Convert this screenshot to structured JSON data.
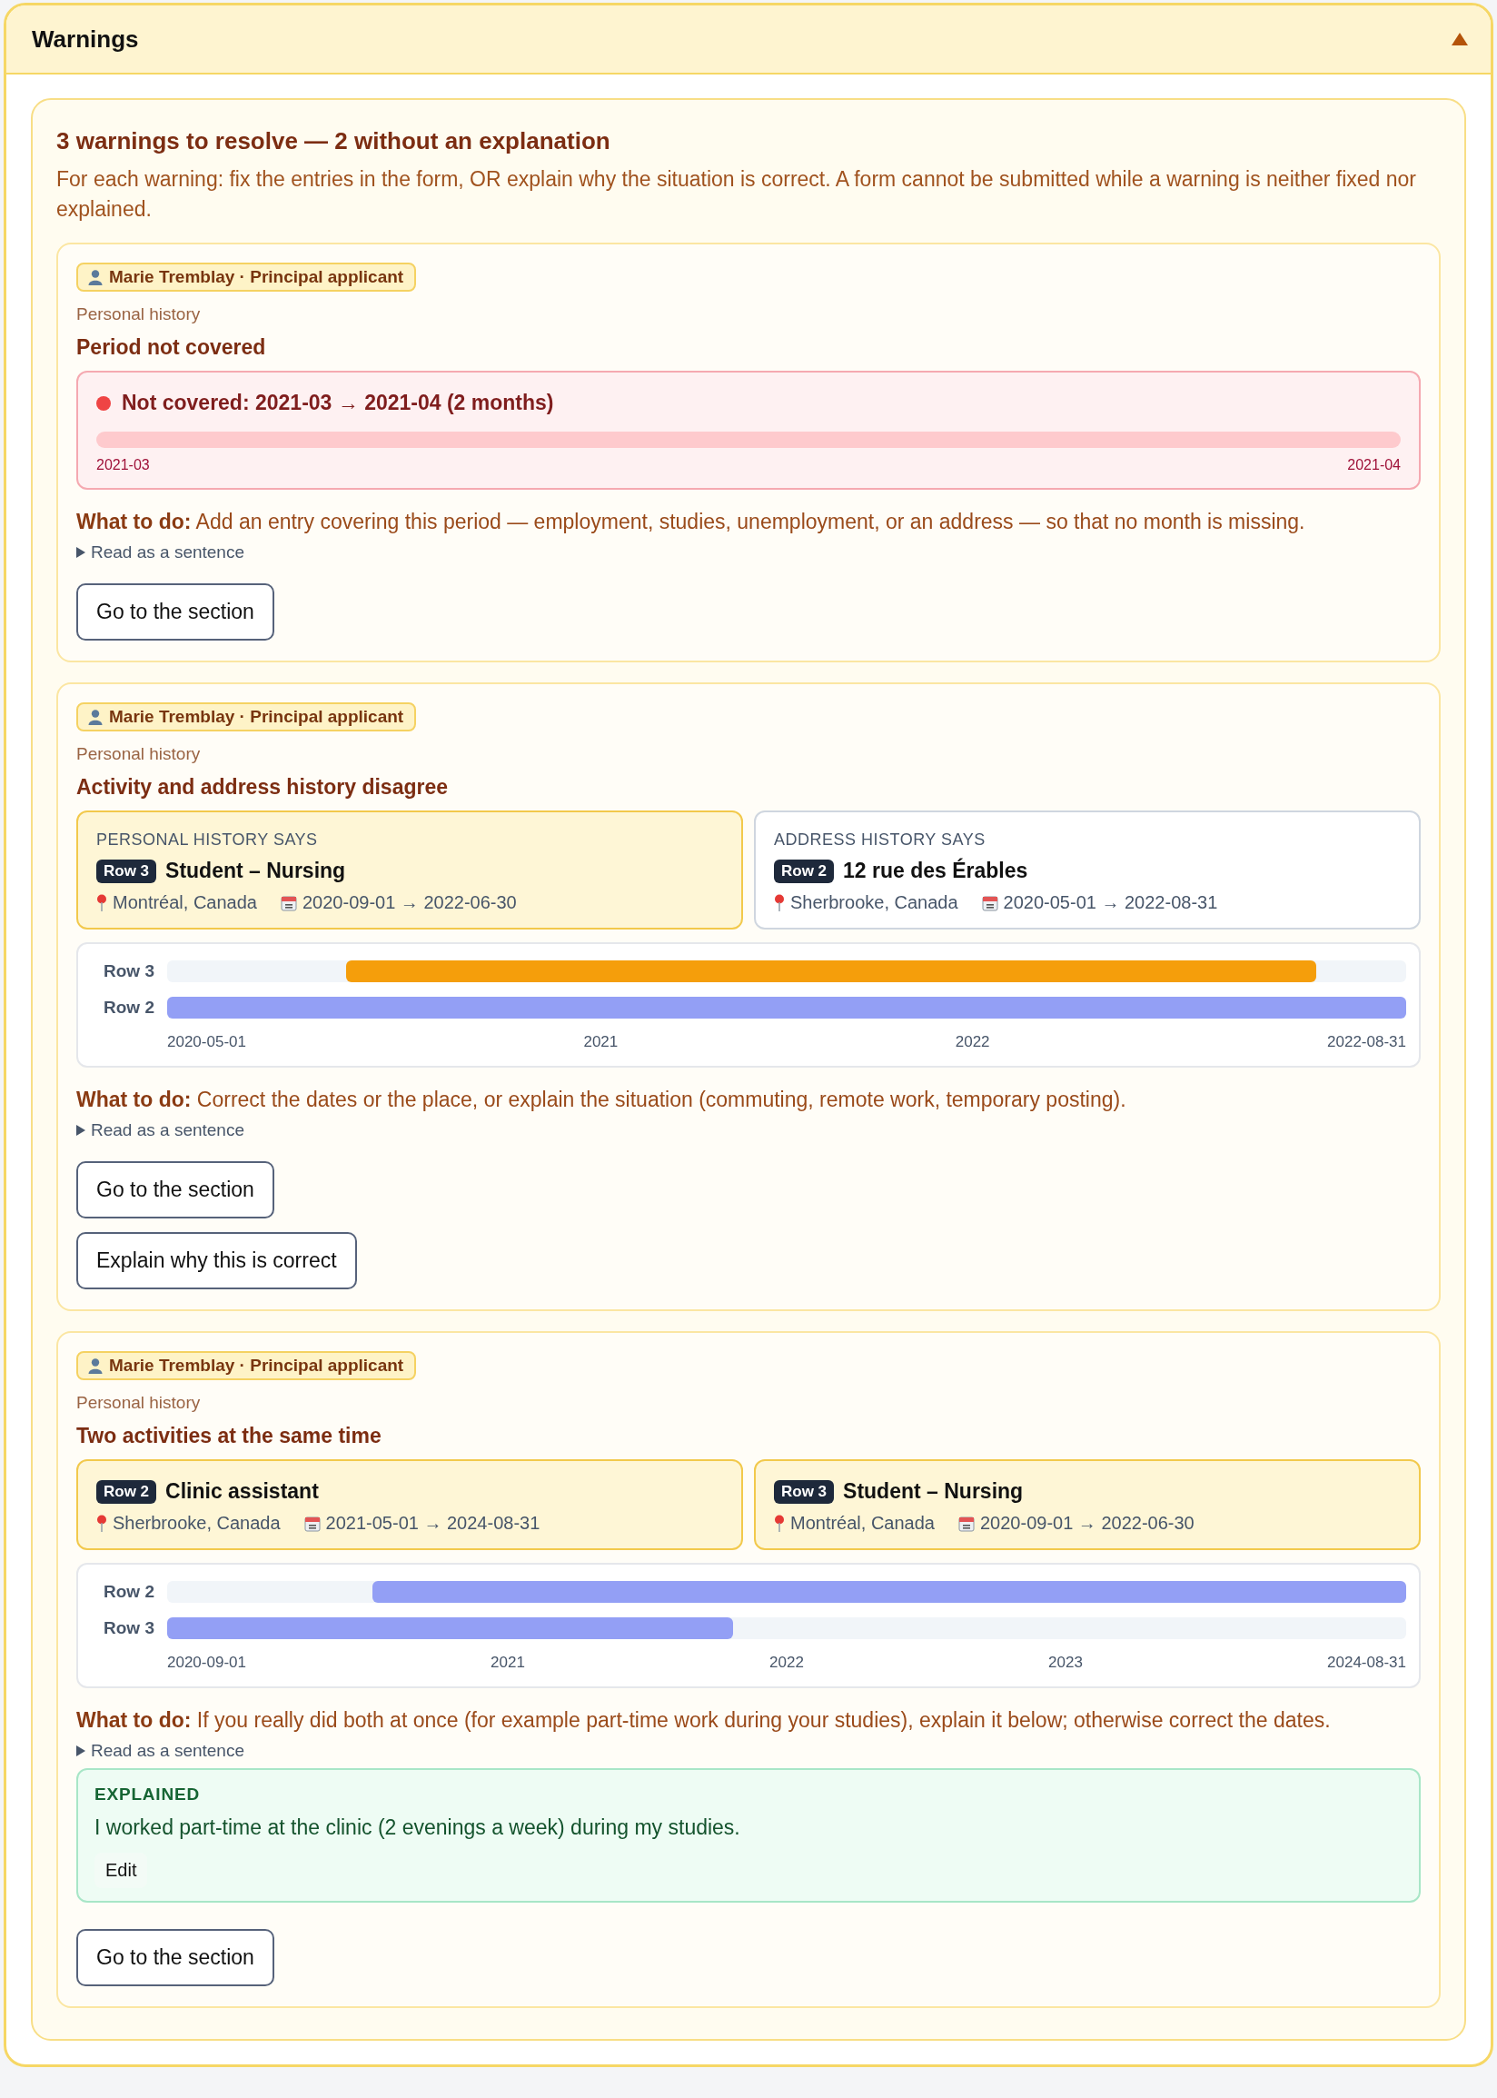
{
  "panel": {
    "title": "Warnings",
    "expanded": true
  },
  "summary": {
    "title": "3 warnings to resolve — 2 without an explanation",
    "description": "For each warning: fix the entries in the form, OR explain why the situation is correct. A form cannot be submitted while a warning is neither fixed nor explained."
  },
  "warnings": [
    {
      "kind": "gap",
      "person": "Marie Tremblay · Principal applicant",
      "section": "Personal history",
      "title": "Period not covered",
      "gap": {
        "label": "Not covered: 2021-03 → 2021-04 (2 months)",
        "from": "2021-03",
        "to": "2021-04"
      },
      "action": "**What to do:** Add an entry covering this period — employment, studies, unemployment, or an address — so that no month is missing.",
      "disclosure": "Read as a sentence",
      "buttons": [
        "Go to the section"
      ]
    },
    {
      "kind": "conflict",
      "person": "Marie Tremblay · Principal applicant",
      "section": "Personal history",
      "title": "Activity and address history disagree",
      "entries": [
        {
          "heading": "PERSONAL HISTORY SAYS",
          "highlighted": true,
          "row": "Row 3",
          "title": "Student – Nursing",
          "place": "Montréal, Canada",
          "dates": "2020-09-01 → 2022-06-30"
        },
        {
          "heading": "ADDRESS HISTORY SAYS",
          "highlighted": false,
          "row": "Row 2",
          "title": "12 rue des Érables",
          "place": "Sherbrooke, Canada",
          "dates": "2020-05-01 → 2022-08-31"
        }
      ],
      "timeline": {
        "ticks": [
          "2020-05-01",
          "2021",
          "2022",
          "2022-08-31"
        ],
        "rows": [
          {
            "label": "Row 3",
            "color": "#f59e0b"
          },
          {
            "label": "Row 2",
            "color": "#939ff5"
          }
        ]
      },
      "action": "**What to do:** Correct the dates or the place, or explain the situation (commuting, remote work, temporary posting).",
      "disclosure": "Read as a sentence",
      "buttons": [
        "Go to the section",
        "Explain why this is correct"
      ]
    },
    {
      "kind": "conflict",
      "person": "Marie Tremblay · Principal applicant",
      "section": "Personal history",
      "title": "Two activities at the same time",
      "entries": [
        {
          "highlighted": true,
          "row": "Row 2",
          "title": "Clinic assistant",
          "place": "Sherbrooke, Canada",
          "dates": "2021-05-01 → 2024-08-31"
        },
        {
          "highlighted": true,
          "row": "Row 3",
          "title": "Student – Nursing",
          "place": "Montréal, Canada",
          "dates": "2020-09-01 → 2022-06-30"
        }
      ],
      "timeline": {
        "ticks": [
          "2020-09-01",
          "2021",
          "2022",
          "2023",
          "2024-08-31"
        ],
        "rows": [
          {
            "label": "Row 2",
            "color": "#939ff5"
          },
          {
            "label": "Row 3",
            "color": "#939ff5"
          }
        ]
      },
      "action": "**What to do:** If you really did both at once (for example part-time work during your studies), explain it below; otherwise correct the dates.",
      "disclosure": "Read as a sentence",
      "explanation": {
        "label": "EXPLAINED",
        "text": "I worked part-time at the clinic (2 evenings a week) during my studies.",
        "button": "Edit"
      },
      "buttons": [
        "Go to the section"
      ]
    }
  ]
}
